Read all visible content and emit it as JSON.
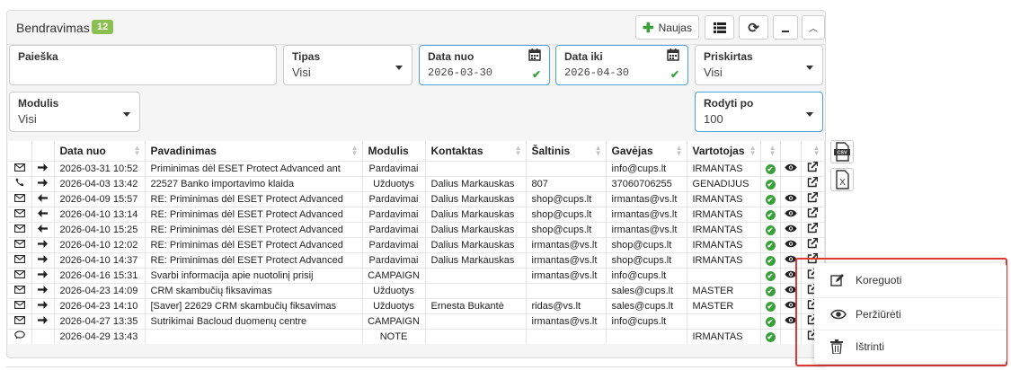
{
  "header": {
    "title": "Bendravimas",
    "count": "12",
    "new_label": "Naujas"
  },
  "filters": {
    "search": {
      "label": "Paieška",
      "value": ""
    },
    "type": {
      "label": "Tipas",
      "value": "Visi"
    },
    "date_from": {
      "label": "Data nuo",
      "value": "2026-03-30"
    },
    "date_to": {
      "label": "Data iki",
      "value": "2026-04-30"
    },
    "assigned": {
      "label": "Priskirtas",
      "value": "Visi"
    },
    "module": {
      "label": "Modulis",
      "value": "Visi"
    },
    "show_per": {
      "label": "Rodyti po",
      "value": "100"
    }
  },
  "table": {
    "columns": [
      "Data nuo",
      "Pavadinimas",
      "Modulis",
      "Kontaktas",
      "Šaltinis",
      "Gavėjas",
      "Vartotojas"
    ],
    "rows": [
      {
        "t": "mail",
        "d": "out",
        "date": "2026-03-31 10:52",
        "title": "Priminimas dėl ESET Protect Advanced ant",
        "module": "Pardavimai",
        "contact": "",
        "source": "",
        "recipient": "info@cups.lt",
        "user": "IRMANTAS",
        "view": true
      },
      {
        "t": "phone",
        "d": "out",
        "date": "2026-04-03 13:42",
        "title": "22527 Banko importavimo klaida",
        "module": "Užduotys",
        "contact": "Dalius Markauskas",
        "source": "807",
        "recipient": "37060706255",
        "user": "GENADIJUS",
        "view": false
      },
      {
        "t": "mail",
        "d": "in",
        "date": "2026-04-09 15:57",
        "title": "RE: Priminimas dėl ESET Protect Advanced",
        "module": "Pardavimai",
        "contact": "Dalius Markauskas",
        "source": "shop@cups.lt",
        "recipient": "irmantas@vs.lt",
        "user": "IRMANTAS",
        "view": true
      },
      {
        "t": "mail",
        "d": "in",
        "date": "2026-04-10 13:14",
        "title": "RE: Priminimas dėl ESET Protect Advanced",
        "module": "Pardavimai",
        "contact": "Dalius Markauskas",
        "source": "shop@cups.lt",
        "recipient": "irmantas@vs.lt",
        "user": "IRMANTAS",
        "view": true
      },
      {
        "t": "mail",
        "d": "in",
        "date": "2026-04-10 15:25",
        "title": "RE: Priminimas dėl ESET Protect Advanced",
        "module": "Pardavimai",
        "contact": "Dalius Markauskas",
        "source": "shop@cups.lt",
        "recipient": "irmantas@vs.lt",
        "user": "IRMANTAS",
        "view": true
      },
      {
        "t": "mail",
        "d": "out",
        "date": "2026-04-10 12:02",
        "title": "RE: Priminimas dėl ESET Protect Advanced",
        "module": "Pardavimai",
        "contact": "Dalius Markauskas",
        "source": "irmantas@vs.lt",
        "recipient": "shop@cups.lt",
        "user": "IRMANTAS",
        "view": true
      },
      {
        "t": "mail",
        "d": "out",
        "date": "2026-04-10 14:37",
        "title": "RE: Priminimas dėl ESET Protect Advanced",
        "module": "Pardavimai",
        "contact": "Dalius Markauskas",
        "source": "irmantas@vs.lt",
        "recipient": "shop@cups.lt",
        "user": "IRMANTAS",
        "view": true
      },
      {
        "t": "mail",
        "d": "out",
        "date": "2026-04-16 15:31",
        "title": "Svarbi informacija apie nuotolinį prisij",
        "module": "CAMPAIGN",
        "contact": "",
        "source": "irmantas@vs.lt",
        "recipient": "info@cups.lt",
        "user": "",
        "view": true
      },
      {
        "t": "mail",
        "d": "out",
        "date": "2026-04-23 14:09",
        "title": "CRM skambučių fiksavimas",
        "module": "Užduotys",
        "contact": "",
        "source": "",
        "recipient": "sales@cups.lt",
        "user": "MASTER",
        "view": true
      },
      {
        "t": "mail",
        "d": "out",
        "date": "2026-04-23 14:10",
        "title": "[Saver] 22629 CRM skambučių fiksavimas",
        "module": "Užduotys",
        "contact": "Ernesta Bukantė",
        "source": "ridas@vs.lt",
        "recipient": "sales@cups.lt",
        "user": "MASTER",
        "view": true
      },
      {
        "t": "mail",
        "d": "out",
        "date": "2026-04-27 13:35",
        "title": "Sutrikimai Bacloud duomenų centre",
        "module": "CAMPAIGN",
        "contact": "",
        "source": "irmantas@vs.lt",
        "recipient": "info@cups.lt",
        "user": "",
        "view": true
      },
      {
        "t": "chat",
        "d": "",
        "date": "2026-04-29 13:43",
        "title": "",
        "module": "NOTE",
        "contact": "",
        "source": "",
        "recipient": "",
        "user": "IRMANTAS",
        "view": false
      }
    ]
  },
  "context_menu": {
    "edit": "Koreguoti",
    "view": "Peržiūrėti",
    "delete": "Ištrinti"
  },
  "colors": {
    "accent_green": "#8cbf52",
    "highlight_border": "#4ba3d6",
    "menu_frame": "#e03838"
  }
}
